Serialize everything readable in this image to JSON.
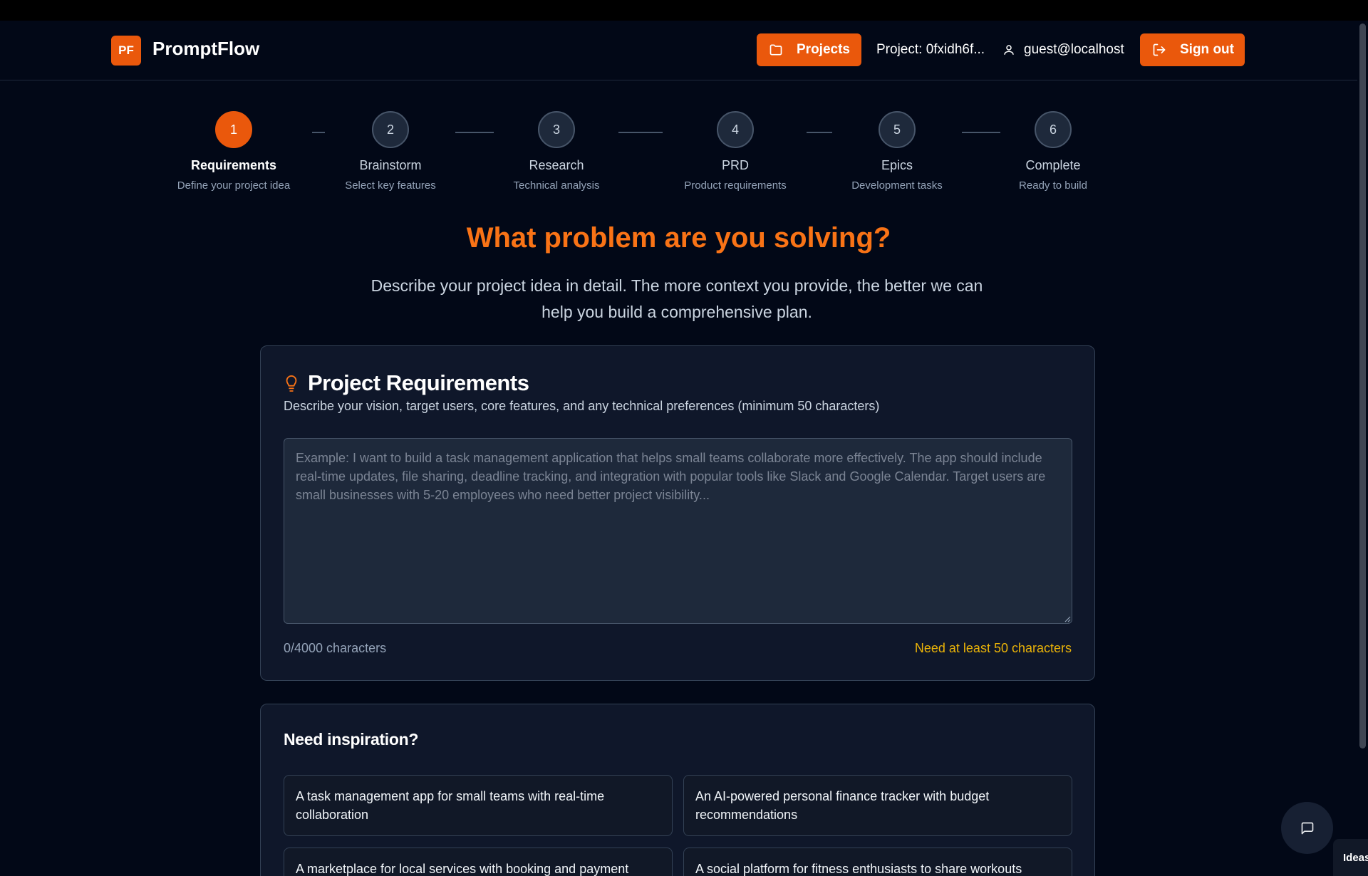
{
  "app": {
    "logo_initials": "PF",
    "name": "PromptFlow",
    "accent_color": "#ea580c"
  },
  "header": {
    "projects_label": "Projects",
    "project_id": "Project: 0fxidh6f...",
    "user_email": "guest@localhost",
    "signout_label": "Sign out"
  },
  "steps": [
    {
      "number": "1",
      "title": "Requirements",
      "subtitle": "Define your project idea",
      "active": true
    },
    {
      "number": "2",
      "title": "Brainstorm",
      "subtitle": "Select key features",
      "active": false
    },
    {
      "number": "3",
      "title": "Research",
      "subtitle": "Technical analysis",
      "active": false
    },
    {
      "number": "4",
      "title": "PRD",
      "subtitle": "Product requirements",
      "active": false
    },
    {
      "number": "5",
      "title": "Epics",
      "subtitle": "Development tasks",
      "active": false
    },
    {
      "number": "6",
      "title": "Complete",
      "subtitle": "Ready to build",
      "active": false
    }
  ],
  "main": {
    "headline": "What problem are you solving?",
    "subheadline": "Describe your project idea in detail. The more context you provide, the better we can help you build a comprehensive plan."
  },
  "requirements_card": {
    "title": "Project Requirements",
    "description": "Describe your vision, target users, core features, and any technical preferences (minimum 50 characters)",
    "textarea_value": "",
    "textarea_placeholder": "Example: I want to build a task management application that helps small teams collaborate more effectively. The app should include real-time updates, file sharing, deadline tracking, and integration with popular tools like Slack and Google Calendar. Target users are small businesses with 5-20 employees who need better project visibility...",
    "char_count": "0/4000 characters",
    "warning": "Need at least 50 characters",
    "warning_color": "#eab308"
  },
  "inspiration": {
    "title": "Need inspiration?",
    "items": [
      "A task management app for small teams with real-time collaboration",
      "An AI-powered personal finance tracker with budget recommendations",
      "A marketplace for local services with booking and payment",
      "A social platform for fitness enthusiasts to share workouts"
    ]
  },
  "floating": {
    "chat_icon": "message-square-icon",
    "ideas_tab_label": "Ideas"
  }
}
